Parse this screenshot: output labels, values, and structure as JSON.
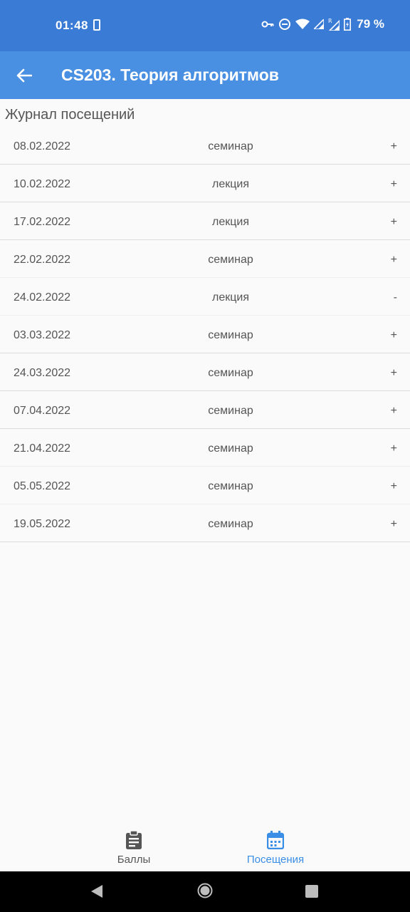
{
  "status_bar": {
    "time": "01:48",
    "battery": "79 %",
    "icons": [
      "phone-icon",
      "vpn-key-icon",
      "dnd-icon",
      "wifi-icon",
      "signal-icon",
      "signal-roaming-icon",
      "battery-charging-icon"
    ]
  },
  "app_bar": {
    "title": "CS203. Теория алгоритмов",
    "back_icon": "arrow-back-icon"
  },
  "section_title": "Журнал посещений",
  "attendance": [
    {
      "date": "08.02.2022",
      "type": "семинар",
      "mark": "+"
    },
    {
      "date": "10.02.2022",
      "type": "лекция",
      "mark": "+"
    },
    {
      "date": "17.02.2022",
      "type": "лекция",
      "mark": "+"
    },
    {
      "date": "22.02.2022",
      "type": "семинар",
      "mark": "+"
    },
    {
      "date": "24.02.2022",
      "type": "лекция",
      "mark": "-"
    },
    {
      "date": "03.03.2022",
      "type": "семинар",
      "mark": "+"
    },
    {
      "date": "24.03.2022",
      "type": "семинар",
      "mark": "+"
    },
    {
      "date": "07.04.2022",
      "type": "семинар",
      "mark": "+"
    },
    {
      "date": "21.04.2022",
      "type": "семинар",
      "mark": "+"
    },
    {
      "date": "05.05.2022",
      "type": "семинар",
      "mark": "+"
    },
    {
      "date": "19.05.2022",
      "type": "семинар",
      "mark": "+"
    }
  ],
  "bottom_nav": {
    "scores_label": "Баллы",
    "attendance_label": "Посещения",
    "active": "attendance",
    "active_color": "#3a8ee6",
    "inactive_color": "#555555"
  },
  "colors": {
    "status_bar": "#3a7bd5",
    "app_bar": "#4a90e2",
    "background": "#fafafa"
  }
}
